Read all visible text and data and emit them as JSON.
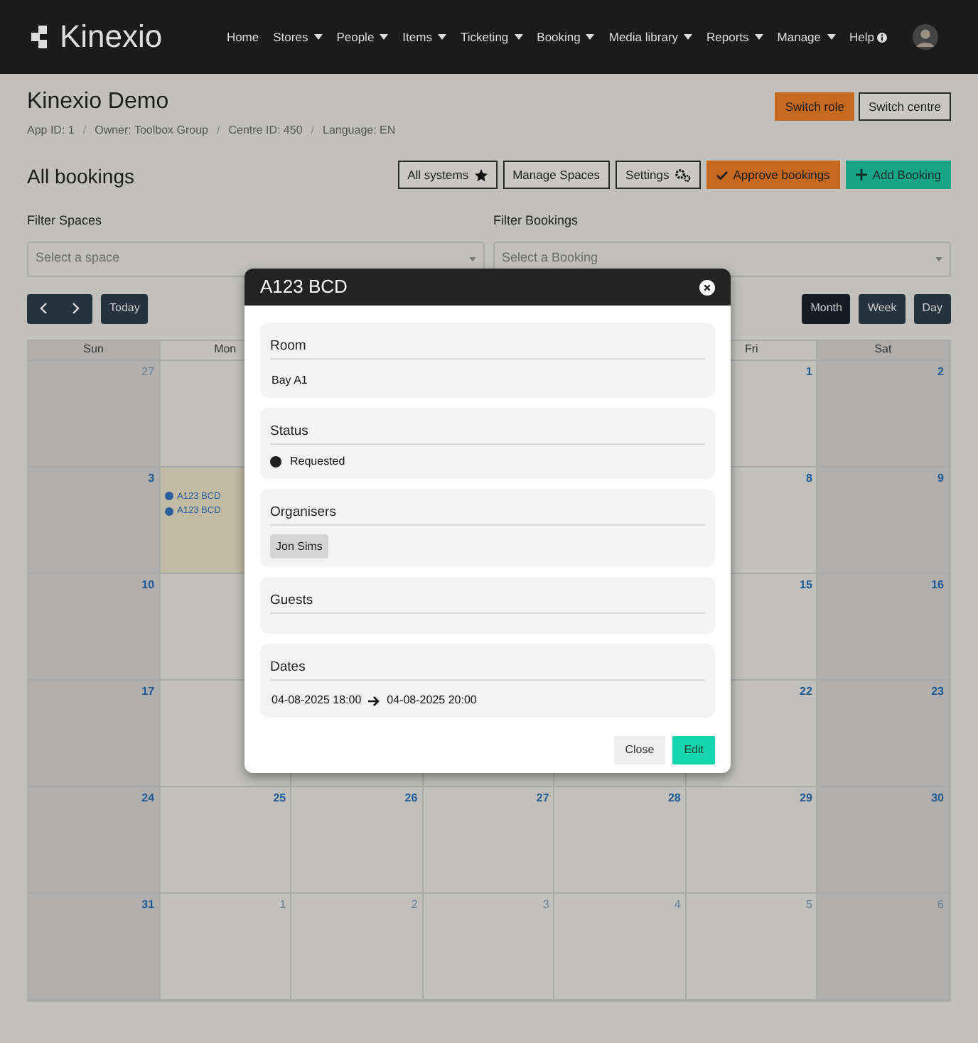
{
  "header": {
    "logo": "Kinexio",
    "nav": [
      {
        "label": "Home",
        "dropdown": false
      },
      {
        "label": "Stores",
        "dropdown": true
      },
      {
        "label": "People",
        "dropdown": true
      },
      {
        "label": "Items",
        "dropdown": true
      },
      {
        "label": "Ticketing",
        "dropdown": true
      },
      {
        "label": "Booking",
        "dropdown": true
      },
      {
        "label": "Media library",
        "dropdown": true
      },
      {
        "label": "Reports",
        "dropdown": true
      },
      {
        "label": "Manage",
        "dropdown": true
      },
      {
        "label": "Help",
        "dropdown": false,
        "info": true
      }
    ]
  },
  "page": {
    "title": "Kinexio Demo",
    "meta": [
      {
        "kind": "item",
        "text": "App ID: 1"
      },
      {
        "kind": "separator",
        "text": "/"
      },
      {
        "kind": "item",
        "text": "Owner: Toolbox Group"
      },
      {
        "kind": "separator",
        "text": "/"
      },
      {
        "kind": "item",
        "text": "Centre ID: 450"
      },
      {
        "kind": "separator",
        "text": "/"
      },
      {
        "kind": "item",
        "text": "Language: EN"
      }
    ],
    "actions": [
      {
        "label": "Switch role",
        "kind": "warning"
      },
      {
        "label": "Switch centre",
        "kind": "outline"
      }
    ]
  },
  "bookings": {
    "title": "All bookings",
    "actions": [
      {
        "label": "All systems",
        "kind": "outline"
      },
      {
        "label": "Manage Spaces",
        "kind": "outline"
      },
      {
        "label": "Settings",
        "kind": "outline"
      },
      {
        "label": "Approve bookings",
        "kind": "warning"
      },
      {
        "label": "Add Booking",
        "kind": "success"
      }
    ],
    "filters": [
      {
        "label": "Filter Spaces",
        "placeholder": "Select a space"
      },
      {
        "label": "Filter Bookings",
        "placeholder": "Select a Booking"
      }
    ],
    "today": "Today",
    "views": [
      {
        "label": "Month",
        "selected": true
      },
      {
        "label": "Week",
        "selected": false
      },
      {
        "label": "Day",
        "selected": false
      }
    ]
  },
  "calendar": {
    "weekdays_left": [
      "Sun",
      "Mon"
    ],
    "weekdays_right": [
      "Fri",
      "Sat"
    ],
    "weeks": [
      {
        "left": [
          {
            "day": "27",
            "other_month": true
          }
        ],
        "right": [
          {
            "day": "1",
            "other_month": false
          },
          {
            "day": "2",
            "other_month": false
          }
        ]
      },
      {
        "left": [
          {
            "day": "3",
            "other_month": false
          },
          {
            "today": true,
            "events": [
              {
                "title": "A123 BCD",
                "color": "#2a5f9e"
              },
              {
                "title": "A123 BCD",
                "color": "#2a5f9e"
              }
            ]
          }
        ],
        "right": [
          {
            "day": "8",
            "other_month": false
          },
          {
            "day": "9",
            "other_month": false
          }
        ]
      },
      {
        "left": [
          {
            "day": "10",
            "other_month": false
          }
        ],
        "right": [
          {
            "day": "15",
            "other_month": false
          },
          {
            "day": "16",
            "other_month": false
          }
        ]
      },
      {
        "left": [
          {
            "day": "17",
            "other_month": false
          }
        ],
        "right": [
          {
            "day": "22",
            "other_month": false
          },
          {
            "day": "23",
            "other_month": false
          }
        ]
      },
      {
        "left": [
          {
            "day": "24",
            "other_month": false
          },
          {
            "day": "25",
            "other_month": false
          },
          {
            "day": "26",
            "other_month": false
          },
          {
            "day": "27",
            "other_month": false
          },
          {
            "day": "28",
            "other_month": false
          },
          {
            "day": "29",
            "other_month": false
          },
          {
            "day": "30",
            "other_month": false
          }
        ]
      },
      {
        "left": [
          {
            "day": "31",
            "other_month": false
          },
          {
            "day": "1",
            "other_month": true
          },
          {
            "day": "2",
            "other_month": true
          },
          {
            "day": "3",
            "other_month": true
          },
          {
            "day": "4",
            "other_month": true
          },
          {
            "day": "5",
            "other_month": true
          },
          {
            "day": "6",
            "other_month": true
          }
        ]
      }
    ]
  },
  "modal": {
    "title": "A123 BCD",
    "sections": [
      {
        "kind": "text",
        "heading": "Room",
        "value": "Bay A1"
      },
      {
        "kind": "status",
        "heading": "Status",
        "value": "Requested",
        "color": "#1e1e1e"
      },
      {
        "kind": "chips",
        "heading": "Organisers",
        "chips": [
          "Jon Sims"
        ]
      },
      {
        "kind": "chips",
        "heading": "Guests"
      },
      {
        "kind": "range",
        "heading": "Dates",
        "start": "04-08-2025 18:00",
        "end": "04-08-2025 20:00"
      }
    ],
    "buttons": [
      {
        "label": "Close",
        "kind": "light"
      },
      {
        "label": "Edit",
        "kind": "primary"
      }
    ]
  }
}
